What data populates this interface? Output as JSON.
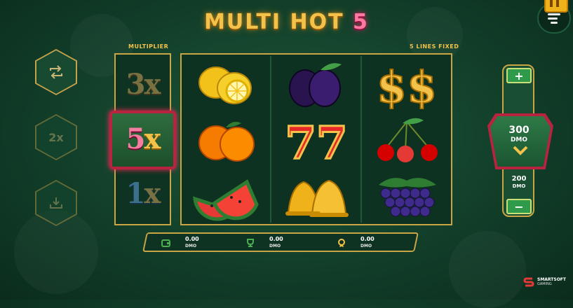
{
  "title": {
    "text": "MULTI HOT",
    "number": "5"
  },
  "multiplier": {
    "label": "MULTIPLIER",
    "values": [
      {
        "num": "3",
        "x": "x"
      },
      {
        "num": "5",
        "x": "x"
      },
      {
        "num": "1",
        "x": "x"
      }
    ],
    "active": "5x"
  },
  "lines_label": "5 LINES FIXED",
  "side_buttons": {
    "autoplay_icon": "repeat-icon",
    "speed_label": "2x",
    "buy_icon": "download-icon"
  },
  "reels": [
    [
      "lemon",
      "orange",
      "watermelon"
    ],
    [
      "plum",
      "seven",
      "bell"
    ],
    [
      "dollar",
      "cherry",
      "grapes"
    ]
  ],
  "stats": [
    {
      "icon": "wallet-icon",
      "value": "0.00",
      "unit": "DMO"
    },
    {
      "icon": "trophy-icon",
      "value": "0.00",
      "unit": "DMO"
    },
    {
      "icon": "medal-icon",
      "value": "0.00",
      "unit": "DMO"
    }
  ],
  "bet": {
    "plus": "+",
    "minus": "−",
    "current": "300",
    "current_unit": "DMO",
    "next": "200",
    "next_unit": "DMO"
  },
  "brand": {
    "name": "SMARTSOFT",
    "sub": "GAMING"
  },
  "colors": {
    "gold": "#c9a545",
    "active_frame": "#b8233f",
    "bg": "#123f2a"
  }
}
